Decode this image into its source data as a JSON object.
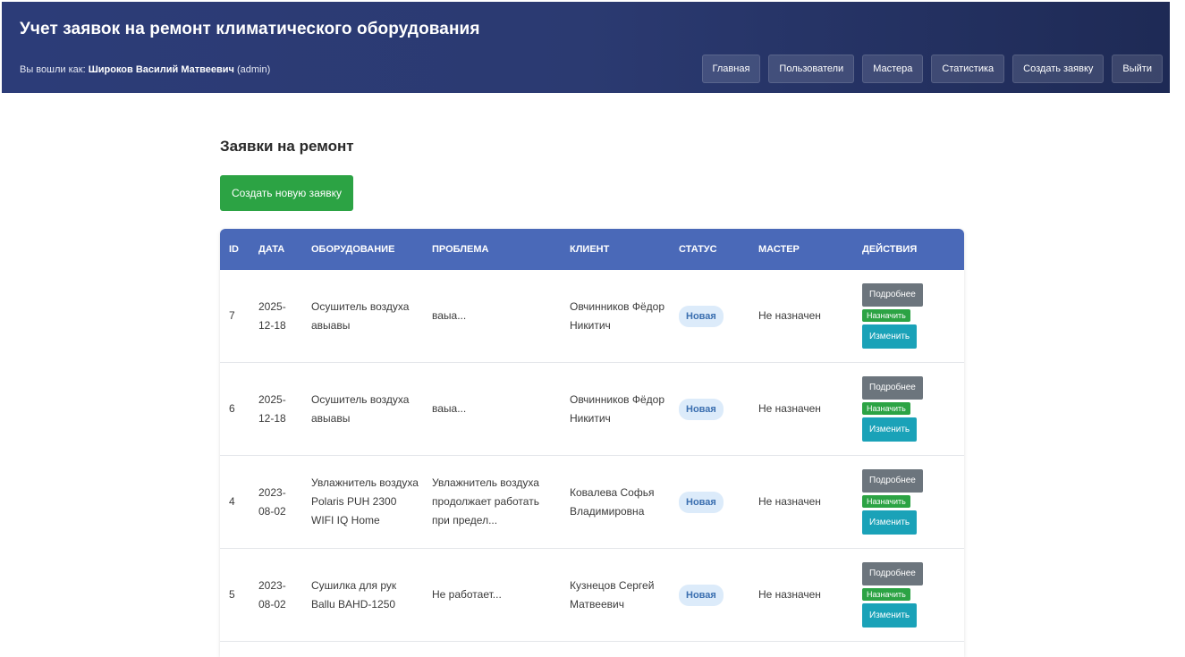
{
  "header": {
    "title": "Учет заявок на ремонт климатического оборудования",
    "user_prefix": "Вы вошли как:",
    "user_name": "Широков Василий Матвеевич",
    "user_role": "(admin)",
    "nav": [
      "Главная",
      "Пользователи",
      "Мастера",
      "Статистика",
      "Создать заявку",
      "Выйти"
    ]
  },
  "main": {
    "title": "Заявки на ремонт",
    "create_button": "Создать новую заявку"
  },
  "table": {
    "columns": [
      "ID",
      "Дата",
      "Оборудование",
      "Проблема",
      "Клиент",
      "Статус",
      "Мастер",
      "Действия"
    ],
    "action_labels": {
      "details": "Подробнее",
      "assign": "Назначить",
      "edit": "Изменить"
    },
    "rows": [
      {
        "id": "7",
        "date": "2025-12-18",
        "equipment": "Осушитель воздуха авыавы",
        "problem": "ваыа...",
        "client": "Овчинников Фёдор Никитич",
        "status": "Новая",
        "master": "Не назначен"
      },
      {
        "id": "6",
        "date": "2025-12-18",
        "equipment": "Осушитель воздуха авыавы",
        "problem": "ваыа...",
        "client": "Овчинников Фёдор Никитич",
        "status": "Новая",
        "master": "Не назначен"
      },
      {
        "id": "4",
        "date": "2023-08-02",
        "equipment": "Увлажнитель воздуха Polaris PUH 2300 WIFI IQ Home",
        "problem": "Увлажнитель воздуха продолжает работать при предел...",
        "client": "Ковалева Софья Владимировна",
        "status": "Новая",
        "master": "Не назначен"
      },
      {
        "id": "5",
        "date": "2023-08-02",
        "equipment": "Сушилка для рук Ballu BAHD-1250",
        "problem": "Не работает...",
        "client": "Кузнецов Сергей Матвеевич",
        "status": "Новая",
        "master": "Не назначен"
      }
    ]
  }
}
